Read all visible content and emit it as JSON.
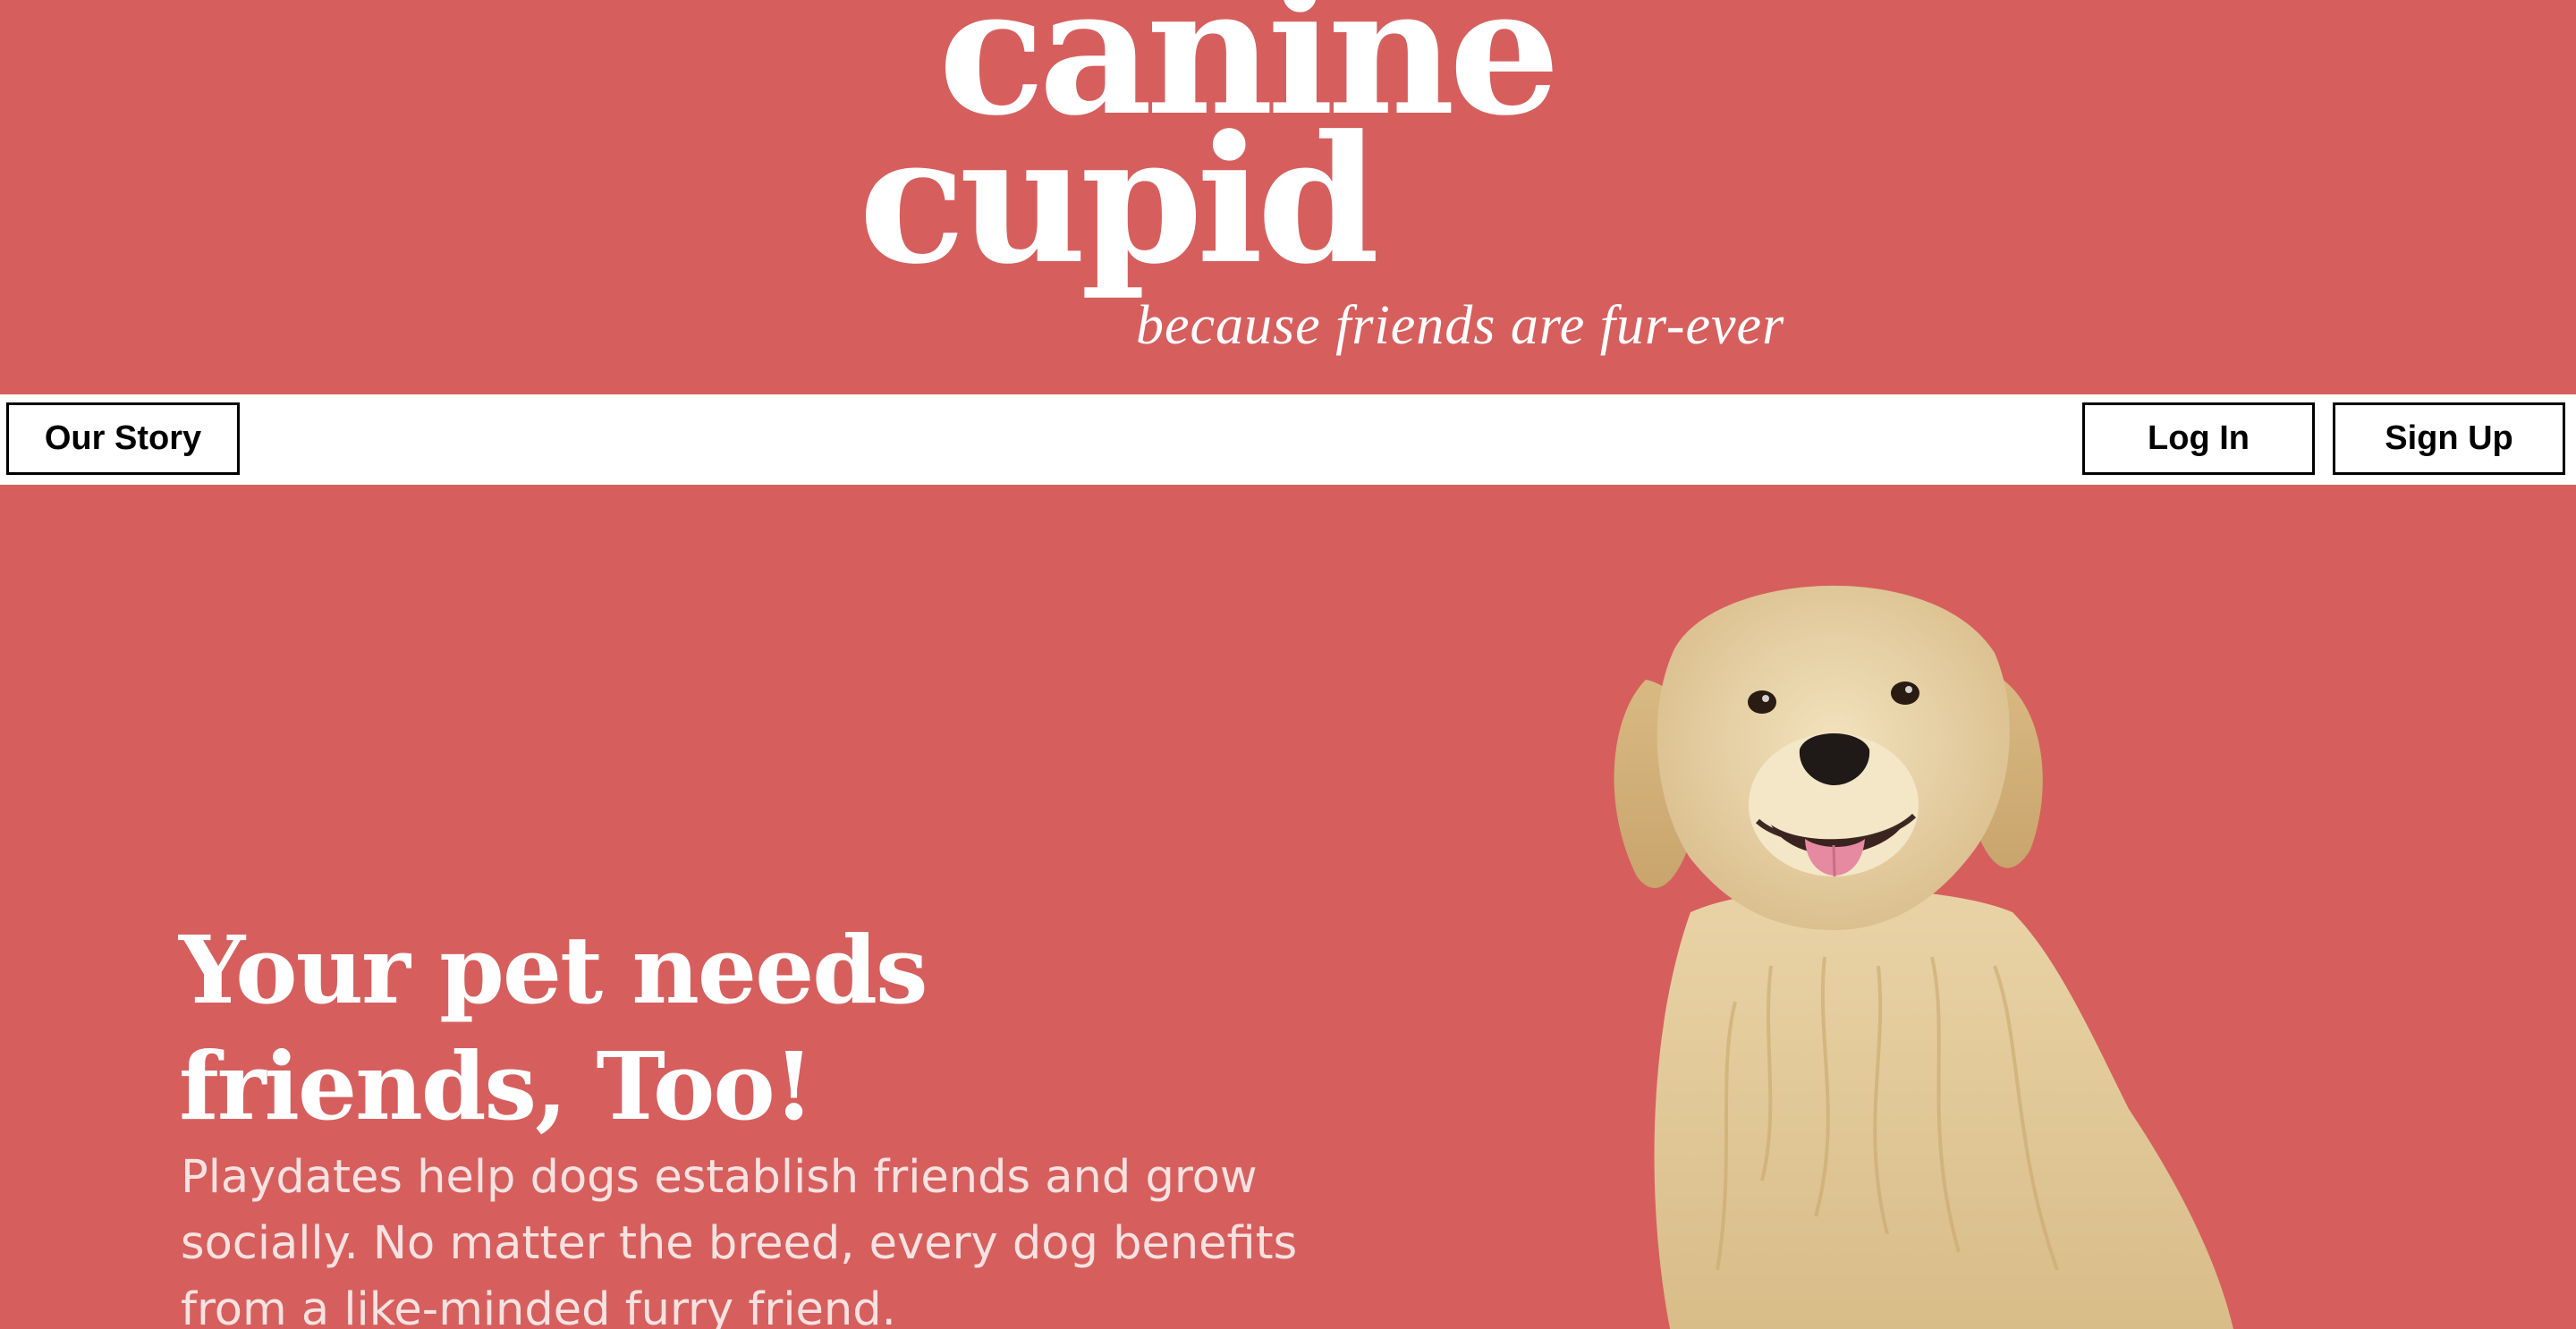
{
  "logo": {
    "line1": "canine",
    "line2": "cupid",
    "tagline": "because friends are fur-ever"
  },
  "nav": {
    "our_story": "Our Story",
    "log_in": "Log In",
    "sign_up": "Sign Up"
  },
  "hero": {
    "title": "Your pet needs friends, Too!",
    "body": "Playdates help dogs establish friends and grow socially. No matter the breed, every dog benefits from a like-minded furry friend."
  },
  "colors": {
    "brand": "#d65f5d",
    "nav_background": "#ffffff",
    "text_light": "#ffffff"
  },
  "images": {
    "hero": "golden-retriever-photo"
  }
}
